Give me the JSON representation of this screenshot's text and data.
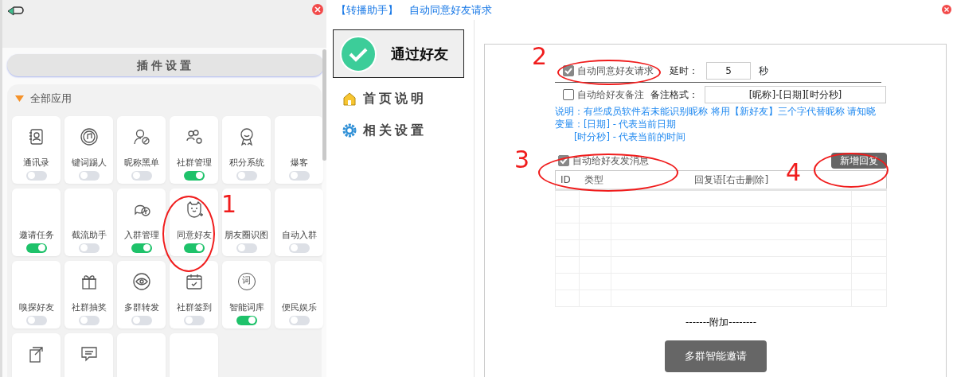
{
  "left_panel": {
    "section_button": "插件设置",
    "group": {
      "title": "全部应用",
      "expanded": true
    },
    "tiles": [
      {
        "label": "通讯录",
        "on": false
      },
      {
        "label": "键词踢人",
        "on": false
      },
      {
        "label": "昵称黑单",
        "on": false
      },
      {
        "label": "社群管理",
        "on": true
      },
      {
        "label": "积分系统",
        "on": false
      },
      {
        "label": "爆客",
        "on": false
      },
      {
        "label": "邀请任务",
        "on": true
      },
      {
        "label": "截流助手",
        "on": false
      },
      {
        "label": "入群管理",
        "on": true
      },
      {
        "label": "同意好友",
        "on": true
      },
      {
        "label": "朋友圈识图",
        "on": false
      },
      {
        "label": "自动入群",
        "on": false
      },
      {
        "label": "嗅探好友",
        "on": false
      },
      {
        "label": "社群抽奖",
        "on": false
      },
      {
        "label": "多群转发",
        "on": false
      },
      {
        "label": "社群签到",
        "on": false
      },
      {
        "label": "智能词库",
        "on": true,
        "icon_char": "词"
      },
      {
        "label": "便民娱乐",
        "on": false
      },
      {
        "has_icon": true
      },
      {
        "has_icon": true
      },
      {
        "has_icon": false
      },
      {
        "has_icon": false
      }
    ]
  },
  "window": {
    "title_tag": "【转播助手】",
    "title": "自动同意好友请求"
  },
  "menu": [
    {
      "label": "通过好友",
      "selected": true
    },
    {
      "label": "首页说明",
      "selected": false
    },
    {
      "label": "相关设置",
      "selected": false
    }
  ],
  "form": {
    "auto_accept": {
      "label": "自动同意好友请求",
      "checked": true
    },
    "delay_label": "延时：",
    "delay_value": "5",
    "delay_unit": "秒",
    "auto_remark": {
      "label": "自动给好友备注",
      "checked": false
    },
    "remark_format_label": "备注格式：",
    "remark_format_value": "[昵称]-[日期][时分秒]",
    "notes": [
      "说明：有些成员软件若未能识别昵称 将用【新好友】三个字代替昵称 请知晓",
      "变量：[日期] - 代表当前日期",
      "[时分秒] - 代表当前的时间"
    ],
    "auto_message": {
      "label": "自动给好友发消息",
      "checked": true
    },
    "add_reply_button": "新增回复",
    "table": {
      "columns": [
        "ID",
        "类型",
        "回复语[右击删除]"
      ]
    },
    "divider_label": "-------附加--------",
    "invite_button": "多群智能邀请"
  },
  "annotations": [
    "1",
    "2",
    "3",
    "4"
  ]
}
